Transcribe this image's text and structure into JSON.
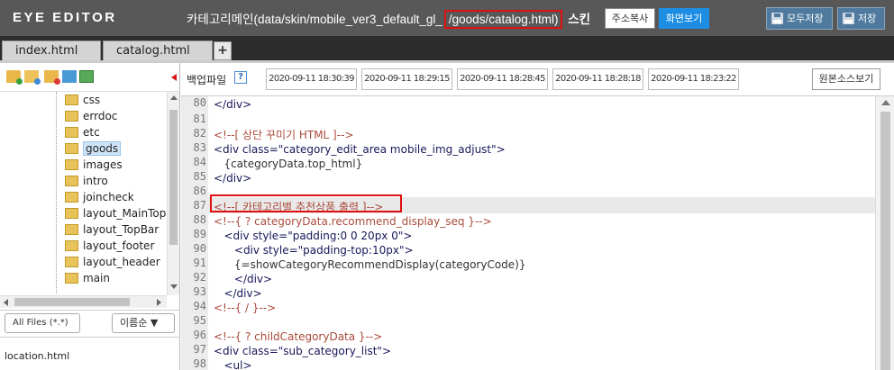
{
  "header": {
    "app_title": "EYE EDITOR",
    "path_prefix": "카테고리메인(data/skin/mobile_ver3_default_gl_",
    "path_highlight": "/goods/catalog.html)",
    "path_suffix": " 스킨",
    "copy_label": "주소복사",
    "view_label": "화면보기",
    "save_all_label": "모두저장",
    "save_label": "저장",
    "view_color": "#1e8ee4"
  },
  "tabs": [
    {
      "label": "index.html"
    },
    {
      "label": "catalog.html"
    }
  ],
  "tab_add_label": "+",
  "sidebar": {
    "tree": [
      "css",
      "errdoc",
      "etc",
      "goods",
      "images",
      "intro",
      "joincheck",
      "layout_MainTopI",
      "layout_TopBar",
      "layout_footer",
      "layout_header",
      "main"
    ],
    "selected": "goods",
    "file_filter": "All Files (*.*)",
    "sort_select": "이름순 ▼",
    "files": [
      "location.html"
    ]
  },
  "backup": {
    "label": "백업파일",
    "help": "?",
    "entries": [
      "2020-09-11 18:30:39",
      "2020-09-11 18:29:15",
      "2020-09-11 18:28:45",
      "2020-09-11 18:28:18",
      "2020-09-11 18:23:22"
    ],
    "original_label": "원본소스보기"
  },
  "editor": {
    "line_numbers": [
      "80",
      "81",
      "82",
      "83",
      "84",
      "85",
      "86",
      "87",
      "88",
      "89",
      "90",
      "91",
      "92",
      "93",
      "94",
      "95",
      "96",
      "97",
      "98"
    ],
    "lines": [
      "</div>",
      "",
      "<!--[ 상단 꾸미기 HTML ]-->",
      "<div class=\"category_edit_area mobile_img_adjust\">",
      "   {categoryData.top_html}",
      "</div>",
      "",
      "<!--[ 카테고리별 추천상품 출력 ]-->",
      "<!--{ ? categoryData.recommend_display_seq }-->",
      "   <div style=\"padding:0 0 20px 0\">",
      "      <div style=\"padding-top:10px\">",
      "      {=showCategoryRecommendDisplay(categoryCode)}",
      "      </div>",
      "   </div>",
      "<!--{ / }-->",
      "",
      "<!--{ ? childCategoryData }-->",
      "<div class=\"sub_category_list\">",
      "   <ul>"
    ]
  }
}
